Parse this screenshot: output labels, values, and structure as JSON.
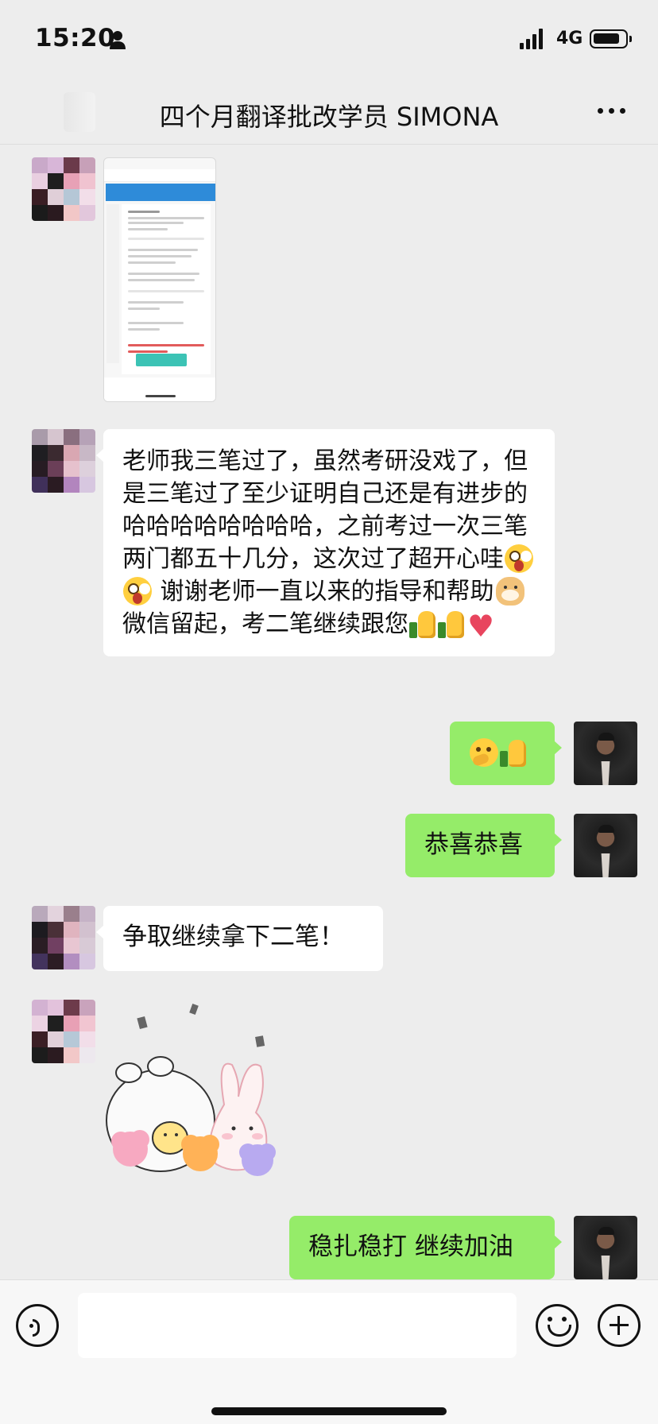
{
  "status_bar": {
    "time": "15:20",
    "network": "4G",
    "signal_bars": 4,
    "icons": [
      "person-icon",
      "signal-icon",
      "battery-icon"
    ]
  },
  "header": {
    "title": "四个月翻译批改学员 SIMONA",
    "back_icon": "back-arrow-icon",
    "more_icon": "more-dots-icon"
  },
  "colors": {
    "background": "#ededed",
    "incoming_bubble": "#ffffff",
    "outgoing_bubble": "#95ec69",
    "text": "#111111"
  },
  "messages": [
    {
      "id": "m1",
      "side": "left",
      "type": "image",
      "description_icon": "screenshot-thumbnail"
    },
    {
      "id": "m2",
      "side": "left",
      "type": "text",
      "text_parts": [
        "老师我三笔过了，虽然考研没戏了，但是三笔过了至少证明自己还是有进步的哈哈哈哈哈哈哈哈，之前考过一次三笔两门都五十几分，这次过了超开心哇",
        "谢谢老师一直以来的指导和帮助",
        "微信留起，考二笔继续跟您"
      ],
      "emojis": [
        "shocked-face-emoji",
        "shocked-face-emoji",
        "doge-emoji",
        "thumbs-up-emoji",
        "thumbs-up-emoji",
        "red-heart-emoji"
      ]
    },
    {
      "id": "m3",
      "side": "right",
      "type": "emoji",
      "emojis": [
        "thinking-face-emoji",
        "thumbs-up-emoji"
      ]
    },
    {
      "id": "m4",
      "side": "right",
      "type": "text",
      "text": "恭喜恭喜"
    },
    {
      "id": "m5",
      "side": "left",
      "type": "text",
      "text": "争取继续拿下二笔！"
    },
    {
      "id": "m6",
      "side": "left",
      "type": "sticker",
      "sticker_icon": "cheering-bunny-sticker"
    },
    {
      "id": "m7",
      "side": "right",
      "type": "text",
      "text": "稳扎稳打 继续加油"
    }
  ],
  "input_bar": {
    "value": "",
    "placeholder": "",
    "icons": [
      "voice-icon",
      "emoji-icon",
      "plus-icon"
    ]
  }
}
